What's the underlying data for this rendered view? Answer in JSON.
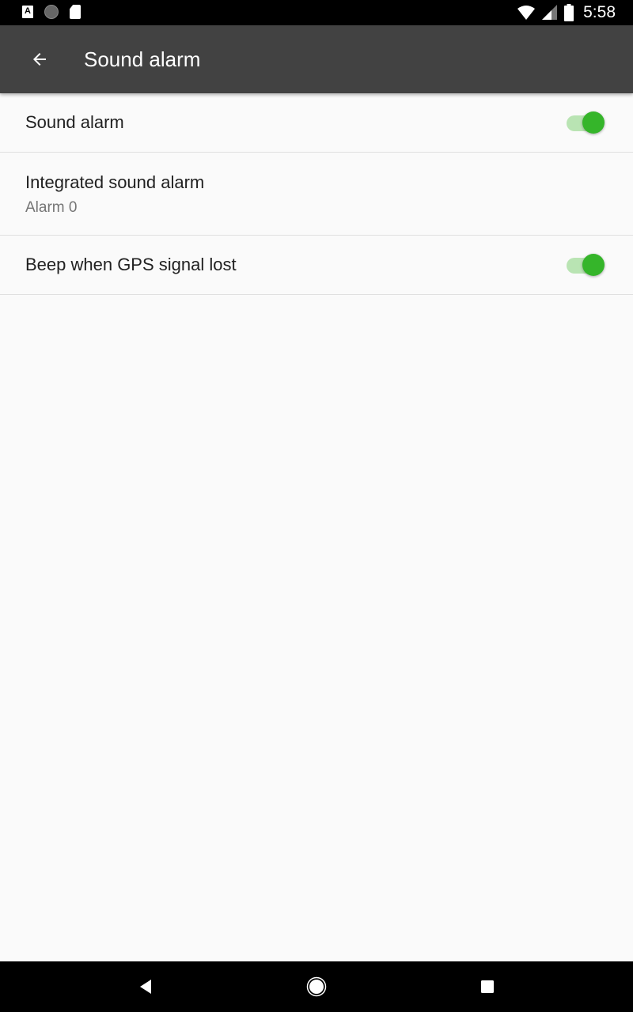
{
  "status_bar": {
    "time": "5:58",
    "left_icons": [
      "accessibility-a-icon",
      "circle-notification-icon",
      "sd-card-icon"
    ],
    "right_icons": [
      "wifi-no-internet-icon",
      "cell-signal-icon",
      "battery-icon"
    ]
  },
  "app_bar": {
    "title": "Sound alarm",
    "back_icon": "arrow-back-icon"
  },
  "settings": [
    {
      "title": "Sound alarm",
      "type": "switch",
      "checked": true
    },
    {
      "title": "Integrated sound alarm",
      "summary": "Alarm 0",
      "type": "list"
    },
    {
      "title": "Beep when GPS signal lost",
      "type": "switch",
      "checked": true
    }
  ],
  "colors": {
    "accent": "#35b52a",
    "track_on": "#b9e4b3",
    "app_bar": "#424242",
    "background": "#fafafa"
  },
  "nav_bar": {
    "back": "nav-back-icon",
    "home": "nav-home-icon",
    "recents": "nav-recents-icon"
  }
}
